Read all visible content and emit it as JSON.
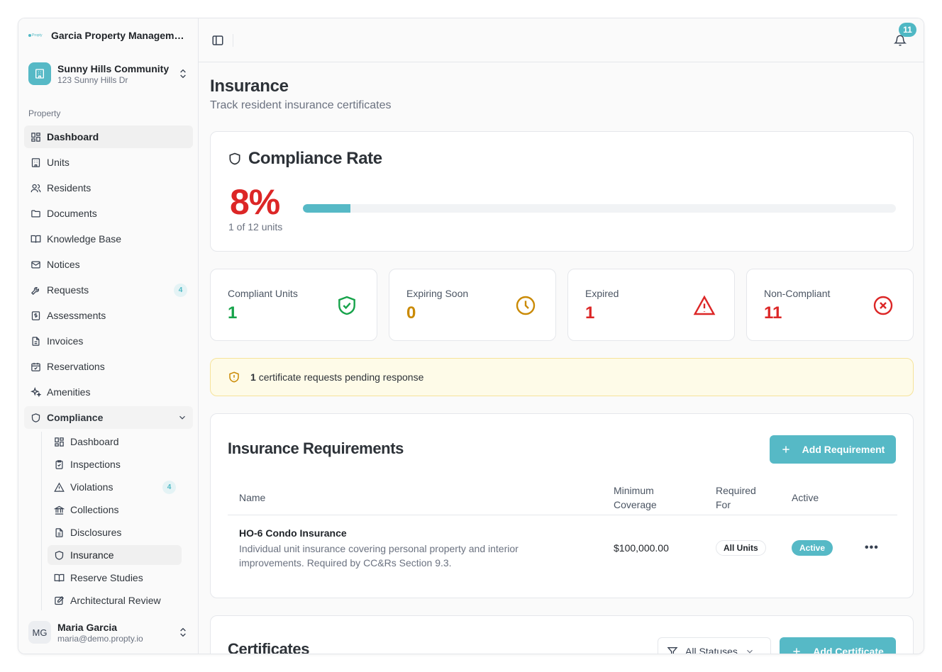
{
  "org": {
    "name": "Garcia Property Management",
    "logo_text": "Propty"
  },
  "community": {
    "name": "Sunny Hills Community",
    "address": "123 Sunny Hills Dr"
  },
  "sidebar": {
    "section_label": "Property",
    "items": [
      {
        "label": "Dashboard",
        "icon": "layout-grid-icon"
      },
      {
        "label": "Units",
        "icon": "building-icon"
      },
      {
        "label": "Residents",
        "icon": "users-icon"
      },
      {
        "label": "Documents",
        "icon": "folder-icon"
      },
      {
        "label": "Knowledge Base",
        "icon": "book-icon"
      },
      {
        "label": "Notices",
        "icon": "mail-icon"
      },
      {
        "label": "Requests",
        "icon": "wrench-icon",
        "badge": "4"
      },
      {
        "label": "Assessments",
        "icon": "dollar-icon"
      },
      {
        "label": "Invoices",
        "icon": "file-icon"
      },
      {
        "label": "Reservations",
        "icon": "calendar-icon"
      },
      {
        "label": "Amenities",
        "icon": "sparkles-icon"
      }
    ],
    "compliance": {
      "label": "Compliance",
      "items": [
        {
          "label": "Dashboard"
        },
        {
          "label": "Inspections"
        },
        {
          "label": "Violations",
          "badge": "4"
        },
        {
          "label": "Collections"
        },
        {
          "label": "Disclosures"
        },
        {
          "label": "Insurance"
        },
        {
          "label": "Reserve Studies"
        },
        {
          "label": "Architectural Review"
        }
      ]
    }
  },
  "user": {
    "initials": "MG",
    "name": "Maria Garcia",
    "email": "maria@demo.propty.io"
  },
  "topbar": {
    "notification_count": "11"
  },
  "page": {
    "title": "Insurance",
    "subtitle": "Track resident insurance certificates"
  },
  "compliance_rate": {
    "title": "Compliance Rate",
    "percent_label": "8%",
    "units_label": "1 of 12 units",
    "progress_fraction": 0.08
  },
  "stats": [
    {
      "label": "Compliant Units",
      "value": "1",
      "color": "#16a34a",
      "icon": "shield-check-icon"
    },
    {
      "label": "Expiring Soon",
      "value": "0",
      "color": "#ca8a04",
      "icon": "clock-icon"
    },
    {
      "label": "Expired",
      "value": "1",
      "color": "#dc2626",
      "icon": "alert-triangle-icon"
    },
    {
      "label": "Non-Compliant",
      "value": "11",
      "color": "#dc2626",
      "icon": "x-circle-icon"
    }
  ],
  "alert": {
    "count": "1",
    "text": "certificate requests pending response"
  },
  "requirements": {
    "title": "Insurance Requirements",
    "add_label": "Add Requirement",
    "columns": {
      "name": "Name",
      "coverage": "Minimum Coverage",
      "required_for": "Required For",
      "active": "Active"
    },
    "rows": [
      {
        "name": "HO-6 Condo Insurance",
        "description": "Individual unit insurance covering personal property and interior improvements. Required by CC&Rs Section 9.3.",
        "coverage": "$100,000.00",
        "required_for": "All Units",
        "active": "Active"
      }
    ]
  },
  "certificates": {
    "title": "Certificates",
    "filter_label": "All Statuses",
    "add_label": "Add Certificate"
  },
  "colors": {
    "accent": "#56b9c6",
    "danger": "#dc2626",
    "success": "#16a34a",
    "warning": "#ca8a04"
  }
}
